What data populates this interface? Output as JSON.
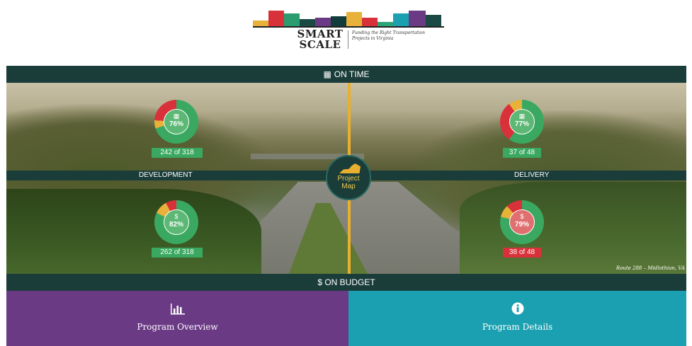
{
  "logo": {
    "title_line1": "SMART",
    "title_line2": "SCALE",
    "tagline": "Funding the Right Transportation Projects in Virginia",
    "bar_colors": [
      "#e7b13a",
      "#d9313a",
      "#2a9d70",
      "#1a4a44",
      "#6b3a85",
      "#123c3a",
      "#e7b13a",
      "#d9313a",
      "#2aa577",
      "#1aa0b0",
      "#6b3a85",
      "#1a4a44"
    ]
  },
  "on_time": {
    "label": "ON TIME",
    "icon": "calendar-icon"
  },
  "on_budget": {
    "label": "$ ON BUDGET",
    "icon": "dollar-icon"
  },
  "development": {
    "label": "DEVELOPMENT",
    "time": {
      "percent": "76%",
      "count": "242 of 318",
      "icon": "calendar-icon",
      "fraction": 0.76
    },
    "budget": {
      "percent": "82%",
      "count": "262 of 318",
      "symbol": "$",
      "fraction": 0.82
    }
  },
  "delivery": {
    "label": "DELIVERY",
    "time": {
      "percent": "77%",
      "count": "37 of 48",
      "icon": "calendar-icon",
      "fraction": 0.77
    },
    "budget": {
      "percent": "79%",
      "count": "38 of 48",
      "symbol": "$",
      "fraction": 0.79
    }
  },
  "project_map": {
    "label_line1": "Project",
    "label_line2": "Map"
  },
  "photo_credit": "Route 288 – Midlothian, VA",
  "buttons": {
    "overview": {
      "label": "Program Overview",
      "icon": "bar-chart-icon",
      "color": "#6b3a85"
    },
    "details": {
      "label": "Program Details",
      "icon": "info-icon",
      "color": "#1aa0b0"
    }
  },
  "colors": {
    "dark_teal": "#1a3d3a",
    "green": "#3aa860",
    "red": "#d9313a",
    "yellow": "#e7b13a"
  }
}
